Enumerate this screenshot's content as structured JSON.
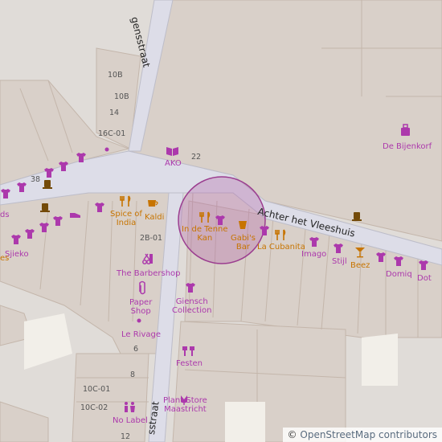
{
  "streets": {
    "top": "gensstraat",
    "achter": "Achter het Vleeshuis",
    "bottom": "sstraat"
  },
  "house_numbers": [
    "10B",
    "10B",
    "14",
    "16C-01",
    "38",
    "22",
    "2B-01",
    "6",
    "8",
    "10C-01",
    "10C-02",
    "12"
  ],
  "places": {
    "ako": "AKO",
    "bijenkorf": "De Bijenkorf",
    "spice_line1": "Spice of",
    "spice_line2": "India",
    "kaldi": "Kaldi",
    "tenne_line1": "In de Tenne",
    "tenne_line2": "Kan",
    "gabis_line1": "Gabi's",
    "gabis_line2": "Bar",
    "cubanita": "La Cubanita",
    "imago": "Imago",
    "stijl": "Stijl",
    "beez": "Beez",
    "domiq": "Domiq",
    "dot": "Dot",
    "sjieko": "Sjieko",
    "left_cut": "ds",
    "left_cut2": "es",
    "barbershop": "The Barbershop",
    "paper_line1": "Paper",
    "paper_line2": "Shop",
    "giensch_line1": "Giensch",
    "giensch_line2": "Collection",
    "rivage": "Le Rivage",
    "festen": "Festen",
    "plant_line1": "Plant Store",
    "plant_line2": "Maastricht",
    "nolabel": "No Label"
  },
  "attribution": {
    "symbol": "©",
    "text": "OpenStreetMap contributors"
  },
  "colors": {
    "background": "#e0dcd8",
    "building": "#d9d0c9",
    "road": "#ffffff",
    "pedestrian": "#dddde8",
    "shop": "#ac39ac",
    "food": "#c77400",
    "highlight": "#b469a8"
  }
}
